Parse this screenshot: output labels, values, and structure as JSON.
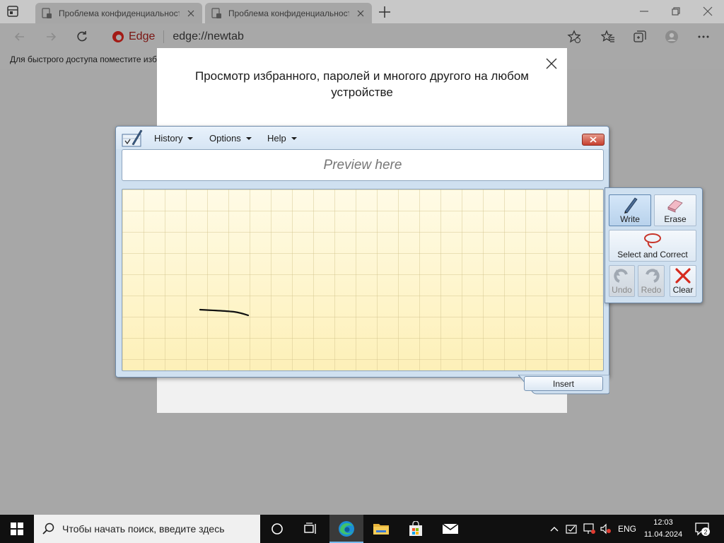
{
  "browser": {
    "tabs": [
      {
        "title": "Проблема конфиденциальност"
      },
      {
        "title": "Проблема конфиденциальност"
      }
    ],
    "address": {
      "brand": "Edge",
      "url": "edge://newtab"
    },
    "favorites_bar_text": "Для быстрого доступа поместите изб"
  },
  "sync_dialog": {
    "title": "Просмотр избранного, паролей и многого другого на любом устройстве"
  },
  "input_panel": {
    "menus": [
      "History",
      "Options",
      "Help"
    ],
    "preview_placeholder": "Preview here",
    "tools": {
      "write": "Write",
      "erase": "Erase",
      "select_correct": "Select and Correct",
      "undo": "Undo",
      "redo": "Redo",
      "clear": "Clear"
    },
    "insert_label": "Insert"
  },
  "taskbar": {
    "search_placeholder": "Чтобы начать поиск, введите здесь",
    "language": "ENG",
    "time": "12:03",
    "date": "11.04.2024",
    "notifications_count": "2"
  },
  "colors": {
    "edge_red": "#c4201b",
    "taskbar_bg": "#101010",
    "paper_yellow": "#fff3c4",
    "clear_red": "#d62a1e"
  }
}
